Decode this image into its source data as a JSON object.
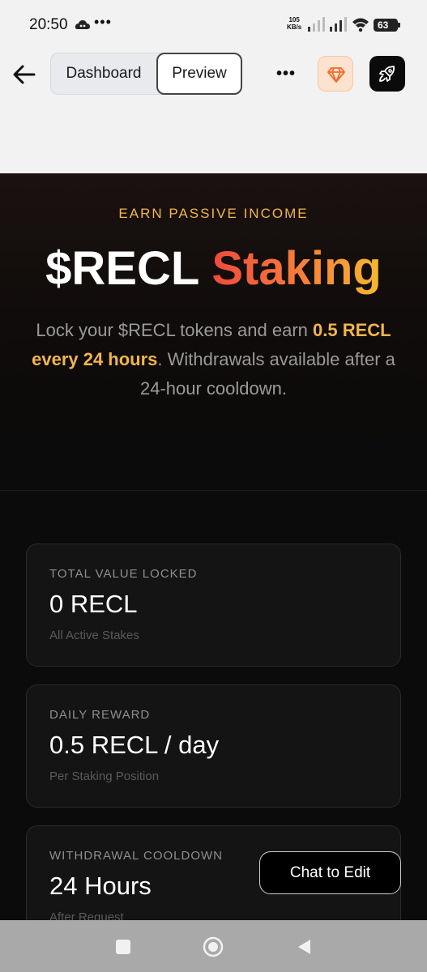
{
  "status_bar": {
    "time": "20:50",
    "more": "•••",
    "speed_value": "105",
    "speed_unit": "KB/s",
    "battery": "63"
  },
  "header": {
    "tabs": [
      {
        "label": "Dashboard",
        "selected": false
      },
      {
        "label": "Preview",
        "selected": true
      }
    ],
    "more_label": "•••",
    "icons": {
      "back": "arrow-left-icon",
      "gem": "gem-icon",
      "rocket": "rocket-icon"
    },
    "gem_color": "#f26b2a"
  },
  "hero": {
    "eyebrow": "EARN PASSIVE INCOME",
    "title_main": "$RECL",
    "title_accent": "Staking",
    "desc_part1": "Lock your $RECL tokens and earn ",
    "desc_highlight1": "0.5 RECL every 24 hours",
    "desc_part2": ". Withdrawals available after a 24-hour cooldown.",
    "accent_color": "#f3b54a"
  },
  "stats": [
    {
      "label": "TOTAL VALUE LOCKED",
      "value": "0 RECL",
      "sub": "All Active Stakes"
    },
    {
      "label": "DAILY REWARD",
      "value": "0.5 RECL / day",
      "sub": "Per Staking Position"
    },
    {
      "label": "WITHDRAWAL COOLDOWN",
      "value": "24 Hours",
      "sub": "After Request"
    }
  ],
  "chat_button": {
    "label": "Chat to Edit"
  },
  "nav": {
    "icons": [
      "recents-icon",
      "home-icon",
      "back-icon"
    ]
  }
}
